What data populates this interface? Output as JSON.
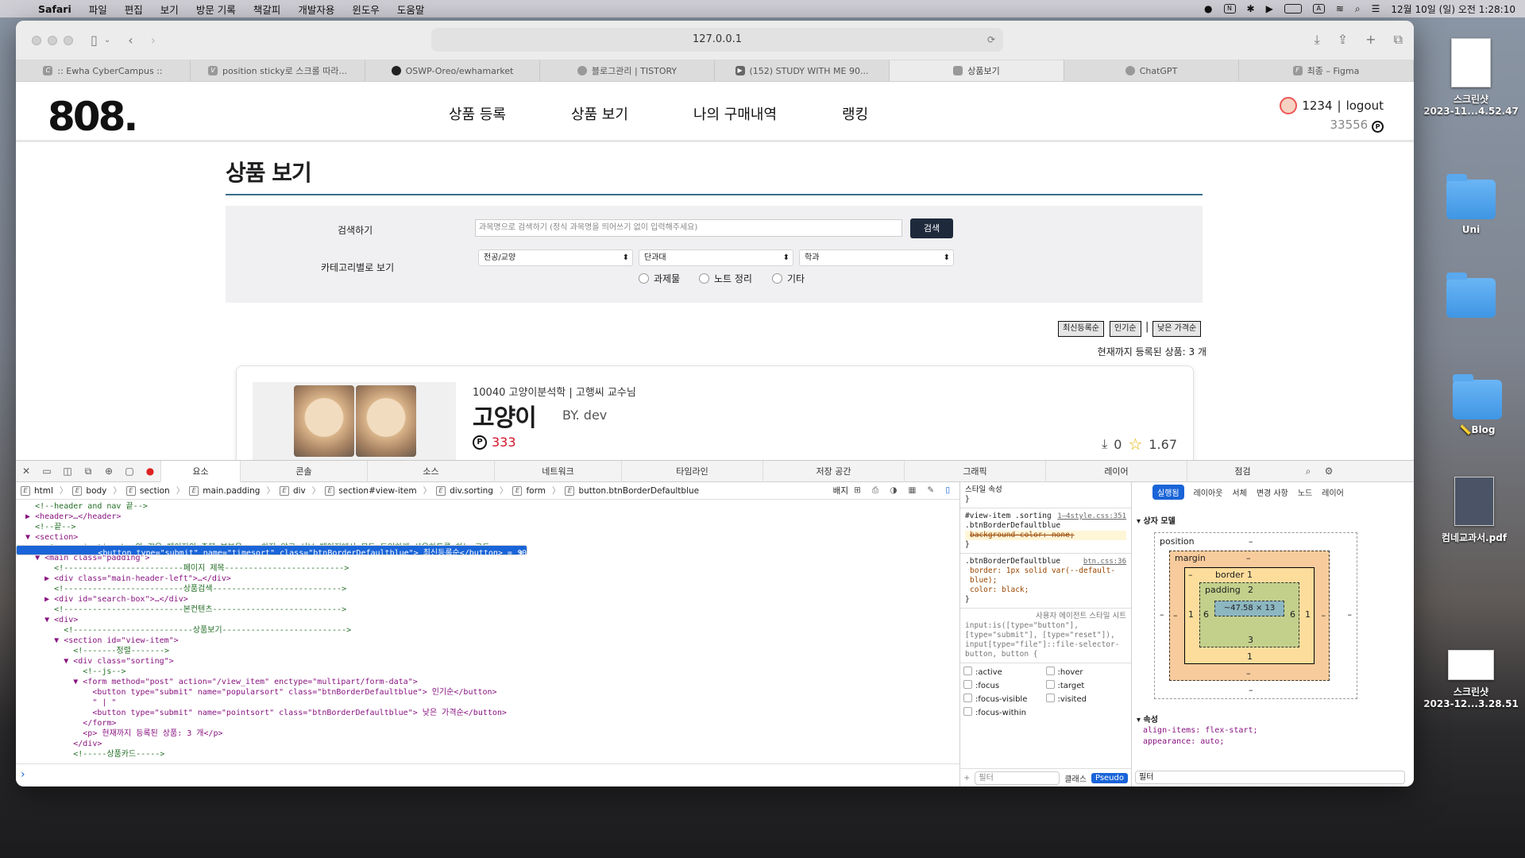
{
  "menubar": {
    "app": "Safari",
    "items": [
      "파일",
      "편집",
      "보기",
      "방문 기록",
      "책갈피",
      "개발자용",
      "윈도우",
      "도움말"
    ],
    "clock": "12월 10일 (일) 오전 1:28:10"
  },
  "desktop": {
    "icons": [
      {
        "label": "스크린샷\n2023-11...4.52.47"
      },
      {
        "label": "Uni"
      },
      {
        "label": ""
      },
      {
        "label": "📏Blog"
      },
      {
        "label": "컴네교과서.pdf"
      },
      {
        "label": "스크린샷\n2023-12...3.28.51"
      }
    ]
  },
  "browser": {
    "url": "127.0.0.1",
    "tabs": [
      ":: Ewha CyberCampus ::",
      "position sticky로 스크롤 따라...",
      "OSWP-Oreo/ewhamarket",
      "블로그관리 | TISTORY",
      "(152) STUDY WITH ME 90...",
      "상품보기",
      "ChatGPT",
      "최종 – Figma"
    ],
    "active_tab": 5
  },
  "site": {
    "logo": "808.",
    "nav": [
      "상품 등록",
      "상품 보기",
      "나의 구매내역",
      "랭킹"
    ],
    "user": {
      "name": "1234",
      "logout": "logout",
      "points": "33556"
    },
    "page_title": "상품 보기",
    "search": {
      "label": "검색하기",
      "placeholder": "과목명으로 검색하기 (정식 과목명을 띄어쓰기 없이 입력해주세요)",
      "button": "검색"
    },
    "category": {
      "label": "카테고리별로 보기",
      "selects": [
        "전공/교양",
        "단과대",
        "학과"
      ],
      "radios": [
        "과제물",
        "노트 정리",
        "기타"
      ]
    },
    "sort": {
      "buttons": [
        "최신등록순",
        "인기순",
        "낮은 가격순"
      ],
      "separator": "|"
    },
    "count_text": "현재까지 등록된 상품: 3 개",
    "card": {
      "course": "10040 고양이분석학 | 고행씨 교수님",
      "title": "고양이",
      "author": "BY. dev",
      "price": "333",
      "downloads": "0",
      "rating": "1.67"
    }
  },
  "devtools": {
    "tabs": [
      "요소",
      "콘솔",
      "소스",
      "네트워크",
      "타임라인",
      "저장 공간",
      "그래픽",
      "레이어",
      "점검"
    ],
    "crumbs": [
      "html",
      "body",
      "section",
      "main.padding",
      "div",
      "section#view-item",
      "div.sorting",
      "form",
      "button.btnBorderDefaultblue"
    ],
    "badge": "배지",
    "styles_title": "스타일 속성",
    "rule1": {
      "selector": "#view-item .sorting .btnBorderDefaultblue",
      "src": "1–4style.css:351",
      "decl": "background-color: none;"
    },
    "rule2": {
      "selector": ".btnBorderDefaultblue",
      "src": "btn.css:36",
      "decl1": "border: 1px solid var(--default-blue);",
      "decl2": "color: black;"
    },
    "ua_title": "사용자 에이전트 스타일 시트",
    "ua_selector": "input:is([type=\"button\"], [type=\"submit\"], [type=\"reset\"]), input[type=\"file\"]::file-selector-button, button {",
    "pseudo": [
      ":active",
      ":hover",
      ":focus",
      ":target",
      ":focus-visible",
      ":visited",
      ":focus-within"
    ],
    "filter": "필터",
    "class_btn": "클래스",
    "pseudo_btn": "Pseudo",
    "computed_tabs": [
      "실행됨",
      "레이아웃",
      "서체",
      "변경 사항",
      "노드",
      "레이어"
    ],
    "box_model_title": "상자 모델",
    "box": {
      "position": "position",
      "margin": "margin",
      "border": "border",
      "padding": "padding",
      "content": "~47.58 × 13",
      "dash": "–",
      "p_top": "2",
      "p_side": "6",
      "p_bottom": "3",
      "b_val": "1"
    },
    "props_title": "속성",
    "props": [
      "align-items: flex-start;",
      "appearance: auto;"
    ]
  }
}
